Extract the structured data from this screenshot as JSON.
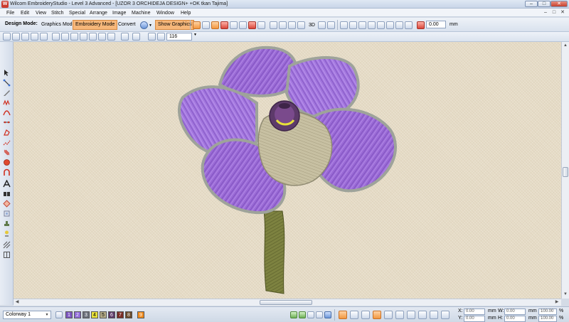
{
  "window": {
    "title": "Wilcom EmbroideryStudio - Level 3 Advanced - [UZOR 3 ORCHIDEJA DESIGN+ +OK tkan       Tajima]",
    "minimize": "–",
    "maximize": "□",
    "close": "✕"
  },
  "menu": {
    "items": [
      "File",
      "Edit",
      "View",
      "Stitch",
      "Special",
      "Arrange",
      "Image",
      "Machine",
      "Window",
      "Help"
    ],
    "mdi_buttons": [
      "–",
      "□",
      "✕"
    ]
  },
  "toolbar": {
    "design_mode_label": "Design Mode:",
    "graphics_mode": "Graphics Mode",
    "embroidery_mode": "Embroidery Mode",
    "convert": "Convert",
    "show_graphics": "Show Graphics",
    "three_d": "3D",
    "rotation_value": "0.00",
    "rotation_unit": "mm",
    "zoom_value": "116"
  },
  "status": {
    "colorway": "Colorway 1",
    "swatches": [
      {
        "label": "1",
        "color": "#7e57c2"
      },
      {
        "label": "2",
        "color": "#8f6ad6"
      },
      {
        "label": "3",
        "color": "#6a6f7a"
      },
      {
        "label": "4",
        "color": "#e6df3a"
      },
      {
        "label": "5",
        "color": "#b6ad88"
      },
      {
        "label": "6",
        "color": "#5d3a6a"
      },
      {
        "label": "7",
        "color": "#7b2e26"
      },
      {
        "label": "8",
        "color": "#6a4a2a"
      },
      {
        "label": "9",
        "color": "#f08a1c"
      }
    ],
    "x_label": "X:",
    "x_value": "0.00",
    "x_unit": "mm",
    "y_label": "Y:",
    "y_value": "0.00",
    "y_unit": "mm",
    "w_label": "W:",
    "w_value": "0.00",
    "w_unit": "mm",
    "h_label": "H:",
    "h_value": "0.00",
    "h_unit": "mm",
    "w_percent": "100.00",
    "h_percent": "100.00",
    "percent_unit": "%"
  },
  "colors": {
    "active_mode": "#f6b77a",
    "canvas_fabric": "#e6dcc7",
    "petal_purple": "#9b6bd6",
    "petal_outline": "#9ea39a",
    "stem_green": "#7a7e3c"
  }
}
